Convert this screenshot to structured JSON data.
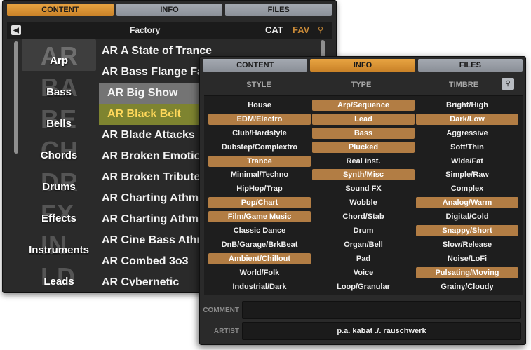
{
  "back_panel": {
    "tabs": [
      "CONTENT",
      "INFO",
      "FILES"
    ],
    "header": {
      "back_icon": "arrow-left-icon",
      "title": "Factory",
      "cat_label": "CAT",
      "fav_label": "FAV",
      "search_icon": "search-icon"
    },
    "categories": [
      {
        "abbr": "AR",
        "label": "Arp"
      },
      {
        "abbr": "BA",
        "label": "Bass"
      },
      {
        "abbr": "BE",
        "label": "Bells"
      },
      {
        "abbr": "CH",
        "label": "Chords"
      },
      {
        "abbr": "DR",
        "label": "Drums"
      },
      {
        "abbr": "FX",
        "label": "Effects"
      },
      {
        "abbr": "IN",
        "label": "Instruments"
      },
      {
        "abbr": "LD",
        "label": "Leads"
      }
    ],
    "presets": [
      "AR A State of Trance",
      "AR Bass Flange Fan",
      "AR Big Show",
      "AR Black Belt",
      "AR Blade Attacks",
      "AR Broken Emotion",
      "AR Broken Tribute",
      "AR Charting Athmo",
      "AR Charting Athmo",
      "AR Cine Bass Athm",
      "AR Combed 3o3",
      "AR Cybernetic"
    ]
  },
  "front_panel": {
    "tabs": [
      "CONTENT",
      "INFO",
      "FILES"
    ],
    "columns": {
      "style": "STYLE",
      "type": "TYPE",
      "timbre": "TIMBRE"
    },
    "search_icon": "search-icon",
    "style_tags": [
      "House",
      "EDM/Electro",
      "Club/Hardstyle",
      "Dubstep/Complextro",
      "Trance",
      "Minimal/Techno",
      "HipHop/Trap",
      "Pop/Chart",
      "Film/Game Music",
      "Classic Dance",
      "DnB/Garage/BrkBeat",
      "Ambient/Chillout",
      "World/Folk",
      "Industrial/Dark"
    ],
    "type_tags": [
      "Arp/Sequence",
      "Lead",
      "Bass",
      "Plucked",
      "Real Inst.",
      "Synth/Misc",
      "Sound FX",
      "Wobble",
      "Chord/Stab",
      "Drum",
      "Organ/Bell",
      "Pad",
      "Voice",
      "Loop/Granular"
    ],
    "timbre_tags": [
      "Bright/High",
      "Dark/Low",
      "Aggressive",
      "Soft/Thin",
      "Wide/Fat",
      "Simple/Raw",
      "Complex",
      "Analog/Warm",
      "Digital/Cold",
      "Snappy/Short",
      "Slow/Release",
      "Noise/LoFi",
      "Pulsating/Moving",
      "Grainy/Cloudy"
    ],
    "comment_label": "COMMENT",
    "comment_value": "",
    "artist_label": "ARTIST",
    "artist_value": "p.a. kabat ./. rauschwerk"
  },
  "colors": {
    "accent_orange": "#e39a3a",
    "tag_selected": "#b27d44",
    "preset_selected_olive": "#7e8430"
  }
}
